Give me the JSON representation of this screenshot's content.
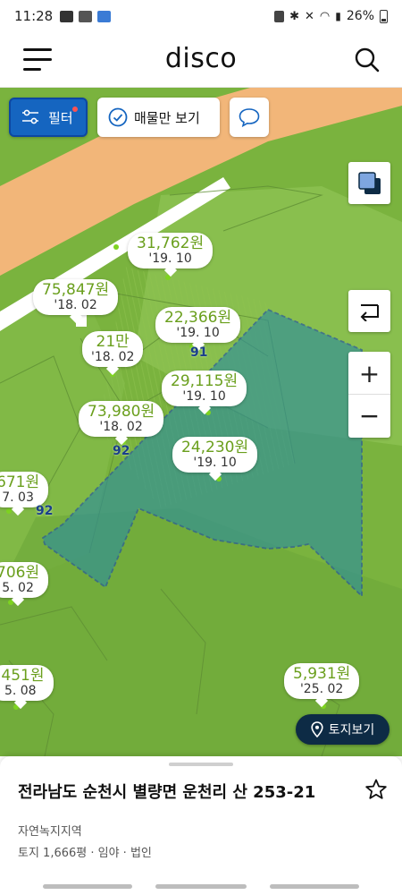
{
  "status_bar": {
    "time": "11:28",
    "battery": "26%"
  },
  "app_bar": {
    "title": "disco",
    "menu_icon": "menu-icon",
    "search_icon": "search-icon"
  },
  "map_controls": {
    "filter_label": "필터",
    "listing_only_label": "매물만 보기",
    "chat_icon": "speech-bubble-icon",
    "layer_icon": "layers-icon",
    "back_icon": "return-arrow-icon",
    "zoom_in": "+",
    "zoom_out": "−",
    "land_view_label": "토지보기"
  },
  "price_tags": [
    {
      "amount": "31,762원",
      "date": "'19. 10"
    },
    {
      "amount": "75,847원",
      "date": "'18. 02"
    },
    {
      "amount": "22,366원",
      "date": "'19. 10"
    },
    {
      "amount": "21만",
      "date": "'18. 02"
    },
    {
      "amount": "29,115원",
      "date": "'19. 10"
    },
    {
      "amount": "73,980원",
      "date": "'18. 02"
    },
    {
      "amount": "24,230원",
      "date": "'19. 10"
    },
    {
      "amount": "671원",
      "date": "7. 03"
    },
    {
      "amount": "706원",
      "date": "5. 02"
    },
    {
      "amount": ",451원",
      "date": "5. 08"
    },
    {
      "amount": "5,931원",
      "date": "'25. 02"
    }
  ],
  "lot_numbers": [
    "91",
    "92",
    "92"
  ],
  "colors": {
    "accent_blue": "#1565c0",
    "price_green": "#6a9f1d",
    "dark_navy": "#0d2b45",
    "map_green": "#7cb342",
    "road_orange": "#f2b679",
    "selected_parcel": "#2f8f9a"
  },
  "bottom_sheet": {
    "address": "전라남도 순천시 별량면 운천리 산 253-21",
    "zone": "자연녹지지역",
    "info": "토지 1,666평 · 임야 · 법인",
    "star_icon": "star-outline-icon"
  }
}
